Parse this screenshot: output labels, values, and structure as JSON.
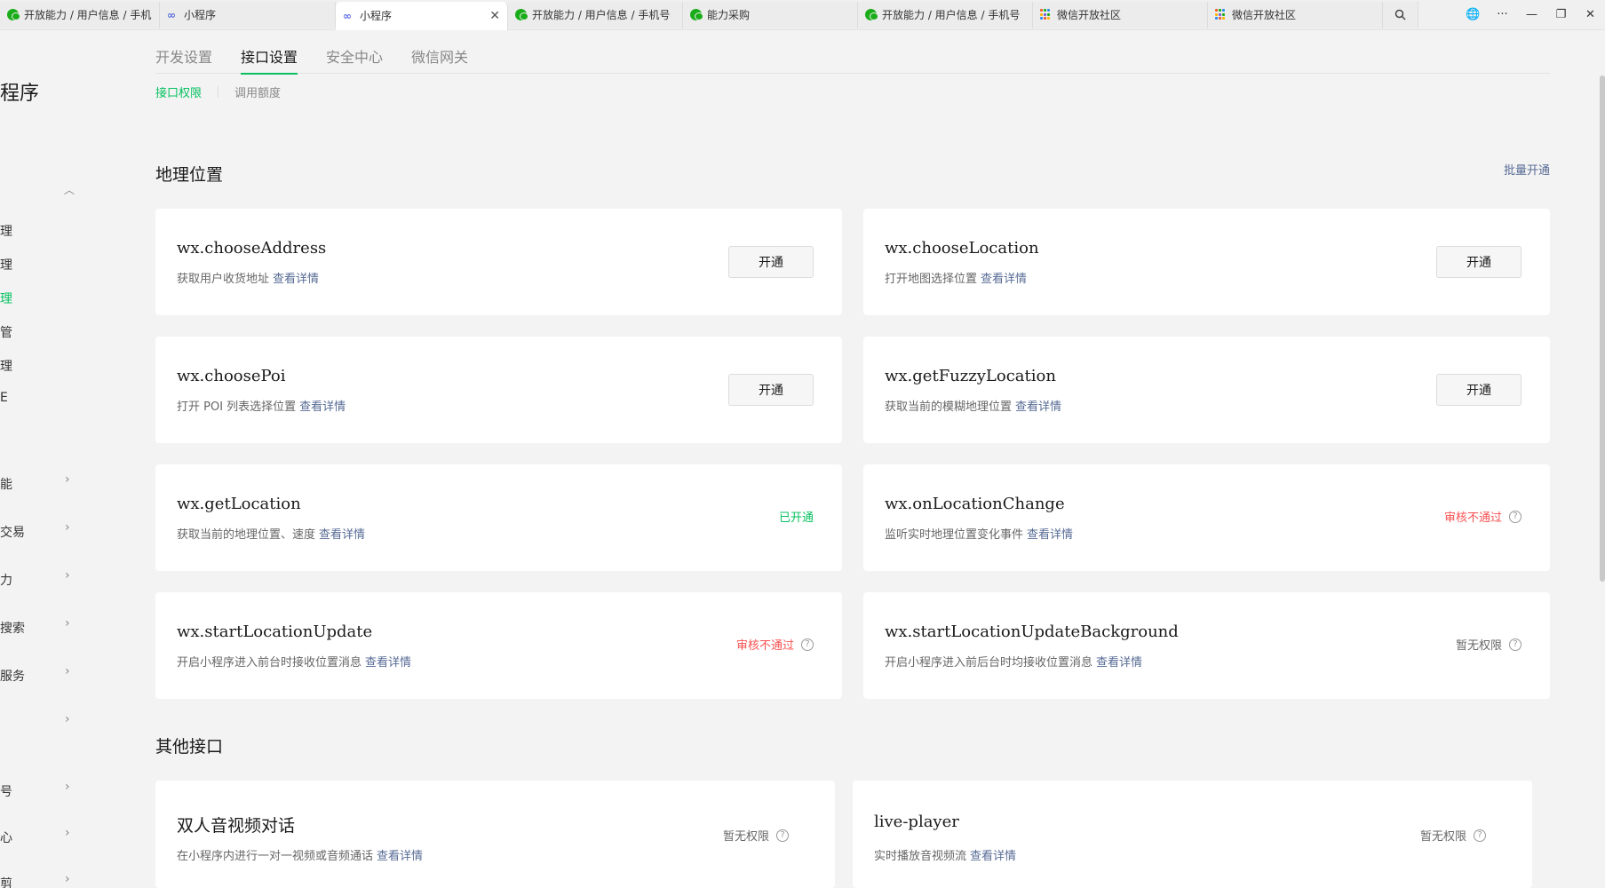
{
  "browser": {
    "tabs": [
      {
        "label": "开放能力 / 用户信息 / 手机号",
        "icon": "wechat-icon",
        "active": false
      },
      {
        "label": "小程序",
        "icon": "link-icon",
        "active": false
      },
      {
        "label": "小程序",
        "icon": "link-icon",
        "active": true
      },
      {
        "label": "开放能力 / 用户信息 / 手机号",
        "icon": "wechat-icon",
        "active": false
      },
      {
        "label": "能力采购",
        "icon": "wechat-icon",
        "active": false
      },
      {
        "label": "开放能力 / 用户信息 / 手机号",
        "icon": "wechat-icon",
        "active": false
      },
      {
        "label": "微信开放社区",
        "icon": "grid-icon",
        "active": false
      },
      {
        "label": "微信开放社区",
        "icon": "grid-icon",
        "active": false
      }
    ],
    "close_glyph": "✕",
    "controls": {
      "globe": "🌐",
      "more": "···",
      "minimize": "—",
      "restore": "❐",
      "close": "✕"
    }
  },
  "sidebar": {
    "title": "程序",
    "collapse_glyph": "︿",
    "sub_items": [
      "理",
      "理",
      "理",
      "管",
      "理",
      "E"
    ],
    "group_items": [
      "能",
      "交易",
      "力",
      "搜索",
      "服务",
      "",
      "号",
      "心",
      "剪"
    ],
    "chevron": "›"
  },
  "main_tabs": [
    "开发设置",
    "接口设置",
    "安全中心",
    "微信网关"
  ],
  "sub_tabs": [
    "接口权限",
    "调用额度"
  ],
  "location_section": {
    "title": "地理位置",
    "bulk_action": "批量开通",
    "cards": [
      {
        "name": "wx.chooseAddress",
        "desc": "获取用户收货地址",
        "detail": "查看详情",
        "action": "开通"
      },
      {
        "name": "wx.chooseLocation",
        "desc": "打开地图选择位置",
        "detail": "查看详情",
        "action": "开通"
      },
      {
        "name": "wx.choosePoi",
        "desc": "打开 POI 列表选择位置",
        "detail": "查看详情",
        "action": "开通"
      },
      {
        "name": "wx.getFuzzyLocation",
        "desc": "获取当前的模糊地理位置",
        "detail": "查看详情",
        "action": "开通"
      },
      {
        "name": "wx.getLocation",
        "desc": "获取当前的地理位置、速度",
        "detail": "查看详情",
        "status": "已开通"
      },
      {
        "name": "wx.onLocationChange",
        "desc": "监听实时地理位置变化事件",
        "detail": "查看详情",
        "status": "审核不通过"
      },
      {
        "name": "wx.startLocationUpdate",
        "desc": "开启小程序进入前台时接收位置消息",
        "detail": "查看详情",
        "status": "审核不通过"
      },
      {
        "name": "wx.startLocationUpdateBackground",
        "desc": "开启小程序进入前后台时均接收位置消息",
        "detail": "查看详情",
        "status": "暂无权限"
      }
    ]
  },
  "other_section": {
    "title": "其他接口",
    "cards": [
      {
        "name": "双人音视频对话",
        "desc": "在小程序内进行一对一视频或音频通话",
        "detail": "查看详情",
        "status": "暂无权限"
      },
      {
        "name": "live-player",
        "desc": "实时播放音视频流",
        "detail": "查看详情",
        "status": "暂无权限"
      }
    ]
  },
  "help_glyph": "?",
  "colors": {
    "accent": "#07c160",
    "link": "#576b95",
    "danger": "#fa5151"
  }
}
